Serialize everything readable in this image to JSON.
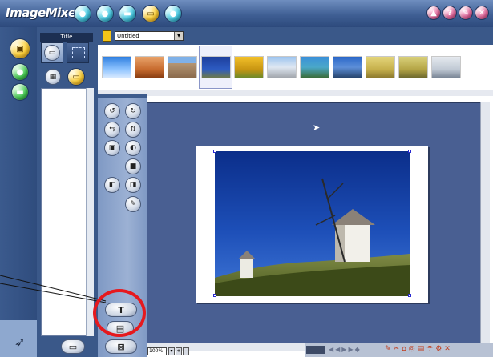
{
  "app": {
    "title": "ImageMixer"
  },
  "left_panel": {
    "tab_label": "Title"
  },
  "top": {
    "dropdown_value": "Untitled"
  },
  "tools": {
    "text_tool_label": "T"
  },
  "statusbar": {
    "zoom": "100%"
  },
  "colors": {
    "accent": "#3a5889",
    "workspace": "#495f92",
    "highlight_circle": "#e6191e",
    "swatch": "#f5c518"
  },
  "thumbnails": [
    "blue-sky-image",
    "desert-dunes-image",
    "colosseum-image",
    "windmill-image",
    "sunflower-field-image",
    "arch-monument-image",
    "coastal-town-image",
    "blue-building-image",
    "yellow-field-image",
    "green-landscape-image",
    "white-building-image"
  ]
}
